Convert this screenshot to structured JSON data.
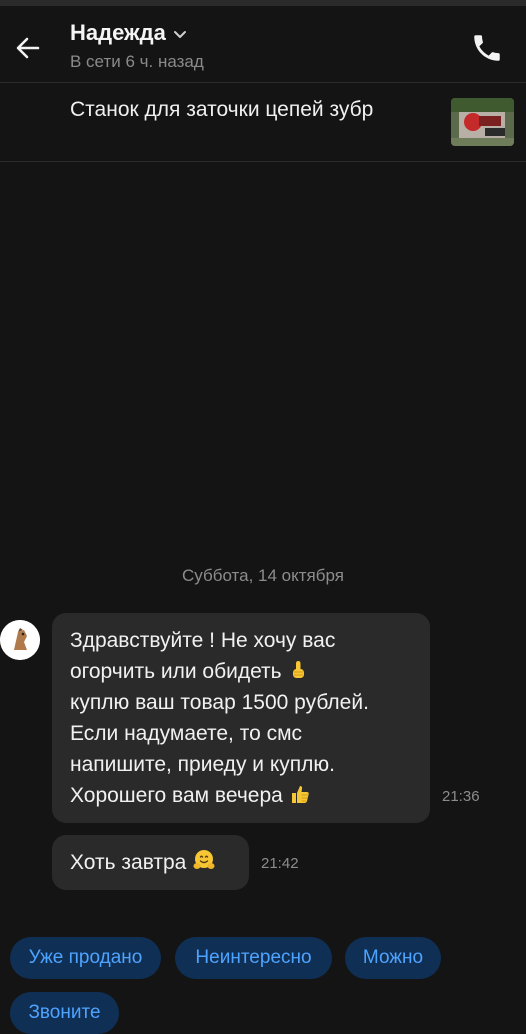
{
  "contact": {
    "name": "Надежда",
    "status": "В сети 6 ч. назад"
  },
  "product": {
    "title": "Станок для заточки цепей зубр"
  },
  "date_separator": "Суббота, 14 октября",
  "messages": [
    {
      "lines": [
        "Здравствуйте !  Не хочу вас",
        "огорчить или обидеть",
        "куплю ваш товар 1500 рублей.",
        "Если надумаете, то смс",
        "напишите, приеду и куплю.",
        "Хорошего вам вечера"
      ],
      "time": "21:36"
    },
    {
      "text": "Хоть завтра",
      "time": "21:42"
    }
  ],
  "quick_replies": [
    "Уже продано",
    "Неинтересно",
    "Можно",
    "Звоните"
  ],
  "colors": {
    "background": "#141414",
    "bubble": "#2a2a2a",
    "chip_bg": "#0f2f55",
    "chip_text": "#4ea3ff"
  },
  "icons": [
    "back-arrow-icon",
    "chevron-down-icon",
    "phone-icon",
    "point-up-emoji-icon",
    "thumbs-up-emoji-icon",
    "hugging-face-emoji-icon"
  ]
}
